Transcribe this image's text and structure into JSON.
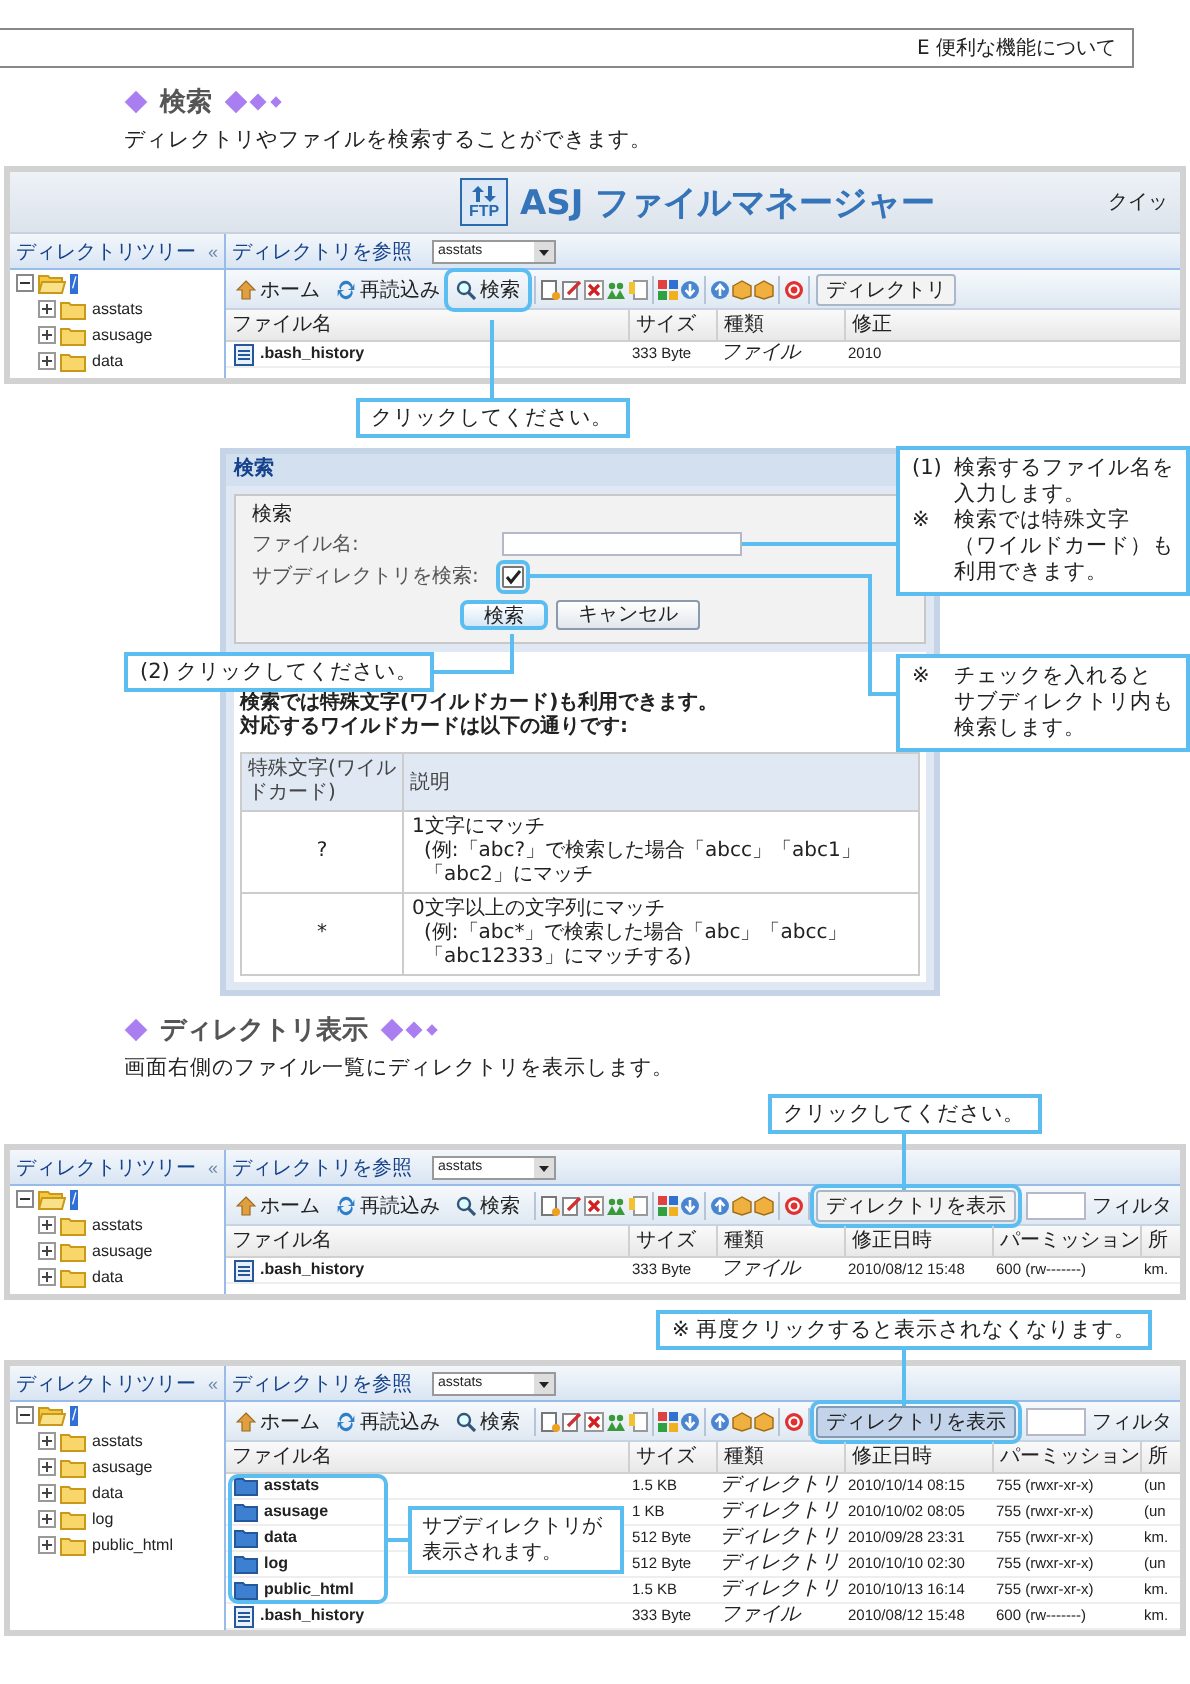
{
  "header": {
    "chapter": "E 便利な機能について"
  },
  "blocks": [
    {
      "kind": "heading",
      "title": "検索"
    },
    {
      "kind": "paragraph",
      "text": "ディレクトリやファイルを検索することができます。"
    },
    {
      "kind": "file_manager",
      "banner": {
        "logo_text": "FTP",
        "title": "ASJ ファイルマネージャー",
        "cut_text": "クイッ"
      },
      "tree": {
        "title": "ディレクトリツリー",
        "collapse": "«",
        "root": {
          "label": "/",
          "selected": true,
          "expanded": true,
          "children": [
            {
              "label": "asstats",
              "selected": false,
              "expanded": false
            },
            {
              "label": "asusage",
              "selected": false,
              "expanded": false
            },
            {
              "label": "data",
              "selected": false,
              "expanded": false
            }
          ]
        }
      },
      "browse": {
        "label": "ディレクトリを参照",
        "value": "asstats"
      },
      "toolbar": [
        {
          "kind": "home",
          "label": "ホーム",
          "highlighted": false,
          "pressed": false
        },
        {
          "kind": "reload",
          "label": "再読込み",
          "highlighted": false,
          "pressed": false
        },
        {
          "kind": "search",
          "label": "検索",
          "highlighted": true,
          "pressed": false
        },
        {
          "kind": "toggle",
          "label": "ディレクトリ",
          "highlighted": false,
          "pressed": false
        }
      ],
      "columns": [
        "ファイル名",
        "サイズ",
        "種類",
        "修正"
      ],
      "rows": [
        {
          "kind": "file",
          "cells": [
            ".bash_history",
            "333 Byte",
            "ファイル",
            "2010"
          ]
        }
      ],
      "callout_below": "クリックしてください。"
    },
    {
      "kind": "dialog",
      "title": "検索",
      "legend": "検索",
      "filename_label": "ファイル名:",
      "subdir": {
        "label": "サブディレクトリを検索:",
        "checked": true,
        "highlighted": true
      },
      "buttons": [
        {
          "label": "検索",
          "highlighted": true
        },
        {
          "label": "キャンセル",
          "highlighted": false
        }
      ],
      "help": [
        "検索では特殊文字(ワイルドカード)も利用できます。",
        "対応するワイルドカードは以下の通りです:"
      ],
      "table": {
        "columns": [
          "特殊文字(ワイルドカード)",
          "説明"
        ],
        "rows": [
          {
            "wildcard": "?",
            "summary": "1文字にマッチ",
            "example": "(例:「abc?」で検索した場合「abcc」「abc1」「abc2」にマッチ"
          },
          {
            "wildcard": "*",
            "summary": "0文字以上の文字列にマッチ",
            "example": "(例:「abc*」で検索した場合「abc」「abcc」「abc12333」にマッチする)"
          }
        ]
      },
      "callout_input": [
        {
          "mark": "(1)",
          "lines": [
            "検索するファイル名を",
            "入力します。"
          ]
        },
        {
          "mark": "※",
          "lines": [
            "検索では特殊文字",
            "（ワイルドカード）も",
            "利用できます。"
          ]
        }
      ],
      "callout_checkbox": [
        {
          "mark": "※",
          "lines": [
            "チェックを入れると",
            "サブディレクトリ内も",
            "検索します。"
          ]
        }
      ],
      "callout_button": "(2) クリックしてください。"
    },
    {
      "kind": "heading",
      "title": "ディレクトリ表示"
    },
    {
      "kind": "paragraph",
      "text": "画面右側のファイル一覧にディレクトリを表示します。"
    },
    {
      "kind": "file_manager",
      "callout_above": "クリックしてください。",
      "tree": {
        "title": "ディレクトリツリー",
        "collapse": "«",
        "root": {
          "label": "/",
          "selected": true,
          "expanded": true,
          "children": [
            {
              "label": "asstats",
              "selected": false,
              "expanded": false
            },
            {
              "label": "asusage",
              "selected": false,
              "expanded": false
            },
            {
              "label": "data",
              "selected": false,
              "expanded": false
            }
          ]
        }
      },
      "browse": {
        "label": "ディレクトリを参照",
        "value": "asstats"
      },
      "toolbar": [
        {
          "kind": "home",
          "label": "ホーム",
          "highlighted": false,
          "pressed": false
        },
        {
          "kind": "reload",
          "label": "再読込み",
          "highlighted": false,
          "pressed": false
        },
        {
          "kind": "search",
          "label": "検索",
          "highlighted": false,
          "pressed": false
        },
        {
          "kind": "toggle",
          "label": "ディレクトリを表示",
          "highlighted": true,
          "pressed": false
        }
      ],
      "filter_label": "フィルタ",
      "columns": [
        "ファイル名",
        "サイズ",
        "種類",
        "修正日時",
        "パーミッション",
        "所"
      ],
      "rows": [
        {
          "kind": "file",
          "cells": [
            ".bash_history",
            "333 Byte",
            "ファイル",
            "2010/08/12 15:48",
            "600 (rw-------)",
            "km."
          ]
        }
      ]
    },
    {
      "kind": "file_manager",
      "callout_above": "※ 再度クリックすると表示されなくなります。",
      "tree": {
        "title": "ディレクトリツリー",
        "collapse": "«",
        "root": {
          "label": "/",
          "selected": true,
          "expanded": true,
          "children": [
            {
              "label": "asstats",
              "selected": false,
              "expanded": false
            },
            {
              "label": "asusage",
              "selected": false,
              "expanded": false
            },
            {
              "label": "data",
              "selected": false,
              "expanded": false
            },
            {
              "label": "log",
              "selected": false,
              "expanded": false
            },
            {
              "label": "public_html",
              "selected": false,
              "expanded": false
            }
          ]
        }
      },
      "browse": {
        "label": "ディレクトリを参照",
        "value": "asstats"
      },
      "toolbar": [
        {
          "kind": "home",
          "label": "ホーム",
          "highlighted": false,
          "pressed": false
        },
        {
          "kind": "reload",
          "label": "再読込み",
          "highlighted": false,
          "pressed": false
        },
        {
          "kind": "search",
          "label": "検索",
          "highlighted": false,
          "pressed": false
        },
        {
          "kind": "toggle",
          "label": "ディレクトリを表示",
          "highlighted": true,
          "pressed": true
        }
      ],
      "filter_label": "フィルタ",
      "columns": [
        "ファイル名",
        "サイズ",
        "種類",
        "修正日時",
        "パーミッション",
        "所"
      ],
      "rows": [
        {
          "kind": "directory",
          "cells": [
            "asstats",
            "1.5 KB",
            "ディレクトリ",
            "2010/10/14 08:15",
            "755 (rwxr-xr-x)",
            "(un"
          ]
        },
        {
          "kind": "directory",
          "cells": [
            "asusage",
            "1 KB",
            "ディレクトリ",
            "2010/10/02 08:05",
            "755 (rwxr-xr-x)",
            "(un"
          ]
        },
        {
          "kind": "directory",
          "cells": [
            "data",
            "512 Byte",
            "ディレクトリ",
            "2010/09/28 23:31",
            "755 (rwxr-xr-x)",
            "km."
          ]
        },
        {
          "kind": "directory",
          "cells": [
            "log",
            "512 Byte",
            "ディレクトリ",
            "2010/10/10 02:30",
            "755 (rwxr-xr-x)",
            "(un"
          ]
        },
        {
          "kind": "directory",
          "cells": [
            "public_html",
            "1.5 KB",
            "ディレクトリ",
            "2010/10/13 16:14",
            "755 (rwxr-xr-x)",
            "km."
          ]
        },
        {
          "kind": "file",
          "cells": [
            ".bash_history",
            "333 Byte",
            "ファイル",
            "2010/08/12 15:48",
            "600 (rw-------)",
            "km."
          ]
        }
      ],
      "directories_highlighted": true,
      "side_callout": "サブディレクトリが表示されます。"
    }
  ]
}
